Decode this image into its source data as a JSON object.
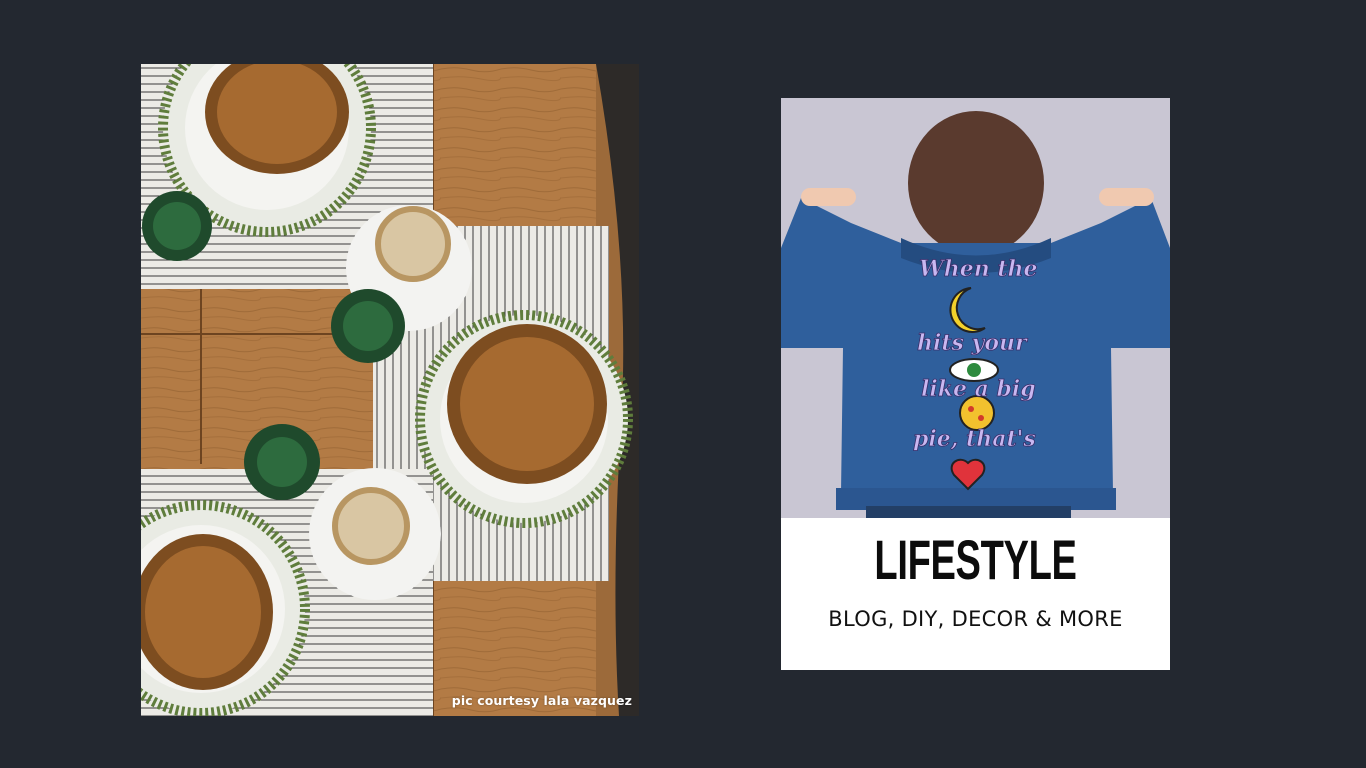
{
  "left_photo": {
    "caption": "pic courtesy lala vazquez"
  },
  "lifestyle_card": {
    "title": "LIFESTYLE",
    "subtitle": "BLOG, DIY, DECOR & MORE",
    "jacket_text": [
      "When the",
      "hits your",
      "like a big",
      "pie, that's"
    ]
  },
  "colors": {
    "background": "#232830",
    "card": "#ffffff",
    "wood": "#b07a45",
    "denim": "#2f5f9c"
  }
}
